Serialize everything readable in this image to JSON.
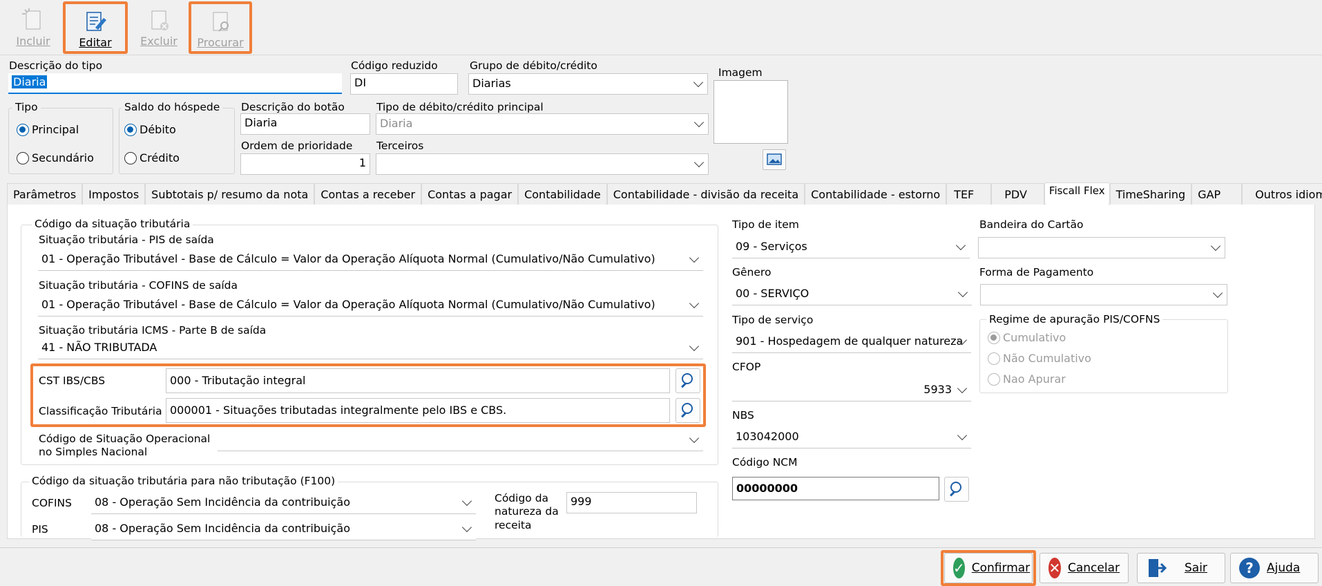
{
  "toolbar": {
    "incluir": "Incluir",
    "editar": "Editar",
    "excluir": "Excluir",
    "procurar": "Procurar"
  },
  "form": {
    "descricao_tipo_label": "Descrição do tipo",
    "descricao_tipo_value": "Diaria",
    "codigo_reduzido_label": "Código reduzido",
    "codigo_reduzido_value": "DI",
    "grupo_label": "Grupo de débito/crédito",
    "grupo_value": "Diarias",
    "imagem_label": "Imagem",
    "tipo_label": "Tipo",
    "tipo_options": [
      "Principal",
      "Secundário"
    ],
    "saldo_label": "Saldo do hóspede",
    "saldo_options": [
      "Débito",
      "Crédito"
    ],
    "descricao_botao_label": "Descrição do botão",
    "descricao_botao_value": "Diaria",
    "tipo_principal_label": "Tipo de débito/crédito principal",
    "tipo_principal_value": "Diaria",
    "ordem_label": "Ordem de prioridade",
    "ordem_value": "1",
    "terceiros_label": "Terceiros",
    "terceiros_value": ""
  },
  "tabs": [
    "Parâmetros",
    "Impostos",
    "Subtotais p/ resumo da nota",
    "Contas a receber",
    "Contas a pagar",
    "Contabilidade",
    "Contabilidade - divisão da receita",
    "Contabilidade - estorno",
    "TEF",
    "PDV",
    "Fiscall Flex",
    "TimeSharing",
    "GAP",
    "Outros idiomas"
  ],
  "active_tab": "Fiscall Flex",
  "cst_group": {
    "title": "Código da situação tributária",
    "pis_label": "Situação tributária - PIS de saída",
    "pis_value": "01 - Operação Tributável - Base de Cálculo = Valor da Operação Alíquota Normal (Cumulativo/Não Cumulativo)",
    "cofins_label": "Situação tributária - COFINS de saída",
    "cofins_value": "01 - Operação Tributável - Base de Cálculo = Valor da Operação Alíquota Normal (Cumulativo/Não Cumulativo)",
    "icms_label": "Situação tributária ICMS -  Parte B de saída",
    "icms_value": "41 - NÃO TRIBUTADA",
    "cst_ibs_label": "CST IBS/CBS",
    "cst_ibs_value": "000 - Tributação integral",
    "class_label": "Classificação Tributária",
    "class_value": "000001 - Situações tributadas integralmente pelo IBS e CBS.",
    "simples_label_1": "Código de Situação Operacional",
    "simples_label_2": "no Simples Nacional",
    "simples_value": ""
  },
  "f100_group": {
    "title": "Código da situação tributária para não tributação (F100)",
    "cofins_label": "COFINS",
    "cofins_value": "08 - Operação Sem Incidência da contribuição",
    "pis_label": "PIS",
    "pis_value": "08 - Operação Sem Incidência da contribuição",
    "natureza_label_1": "Código da",
    "natureza_label_2": "natureza da",
    "natureza_label_3": "receita",
    "natureza_value": "999"
  },
  "right_col": {
    "tipo_item_label": "Tipo de item",
    "tipo_item_value": "09 - Serviços",
    "genero_label": "Gênero",
    "genero_value": "00 - SERVIÇO",
    "tipo_servico_label": "Tipo de serviço",
    "tipo_servico_value": "901 - Hospedagem de qualquer natureza",
    "cfop_label": "CFOP",
    "cfop_value": "5933",
    "nbs_label": "NBS",
    "nbs_value": "103042000",
    "ncm_label": "Código NCM",
    "ncm_value": "00000000",
    "bandeira_label": "Bandeira do Cartão",
    "bandeira_value": "",
    "forma_label": "Forma de Pagamento",
    "forma_value": "",
    "regime_title": "Regime de apuração PIS/COFNS",
    "regime_options": [
      "Cumulativo",
      "Não Cumulativo",
      "Nao Apurar"
    ]
  },
  "bottom": {
    "confirmar": "Confirmar",
    "cancelar": "Cancelar",
    "sair": "Sair",
    "ajuda": "Ajuda"
  },
  "colors": {
    "highlight": "#f07f3a",
    "selection": "#0078d7",
    "confirm": "#2e9e5b",
    "cancel": "#d2372f",
    "help": "#1d5fa8"
  }
}
